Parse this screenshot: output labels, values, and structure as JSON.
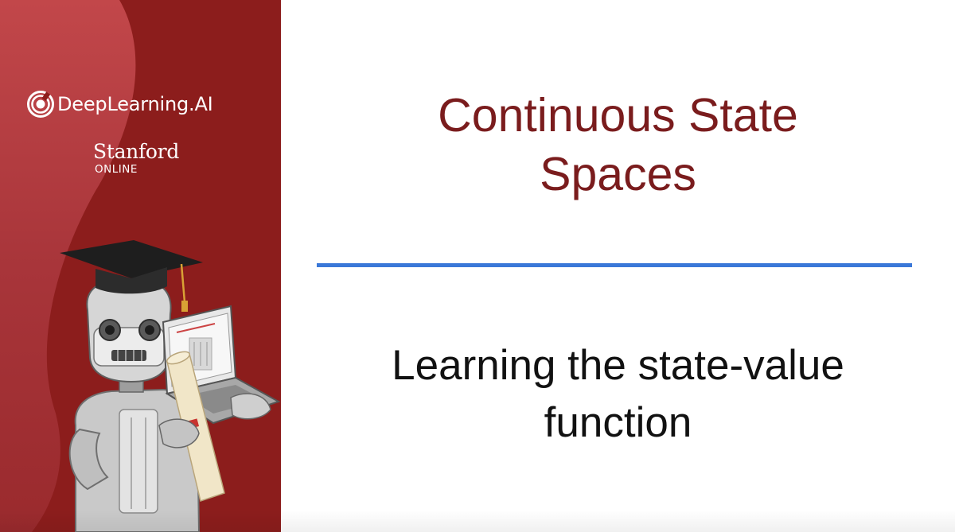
{
  "brand": {
    "deeplearning_logo_text": "DeepLearning.AI",
    "stanford_name": "Stanford",
    "stanford_sub": "ONLINE"
  },
  "slide": {
    "title_lines": [
      "Continuous State",
      "Spaces"
    ],
    "subtitle_lines": [
      "Learning the state-value",
      "function"
    ]
  },
  "illustration": {
    "subject": "graduate-robot-mascot",
    "icons": [
      "graduation-cap-icon",
      "laptop-icon",
      "diploma-scroll-icon"
    ]
  },
  "colors": {
    "sidebar_red": "#8c1d1c",
    "title_red": "#7a1c1d",
    "divider_blue": "#3a78d8",
    "subtitle_text": "#111111"
  }
}
